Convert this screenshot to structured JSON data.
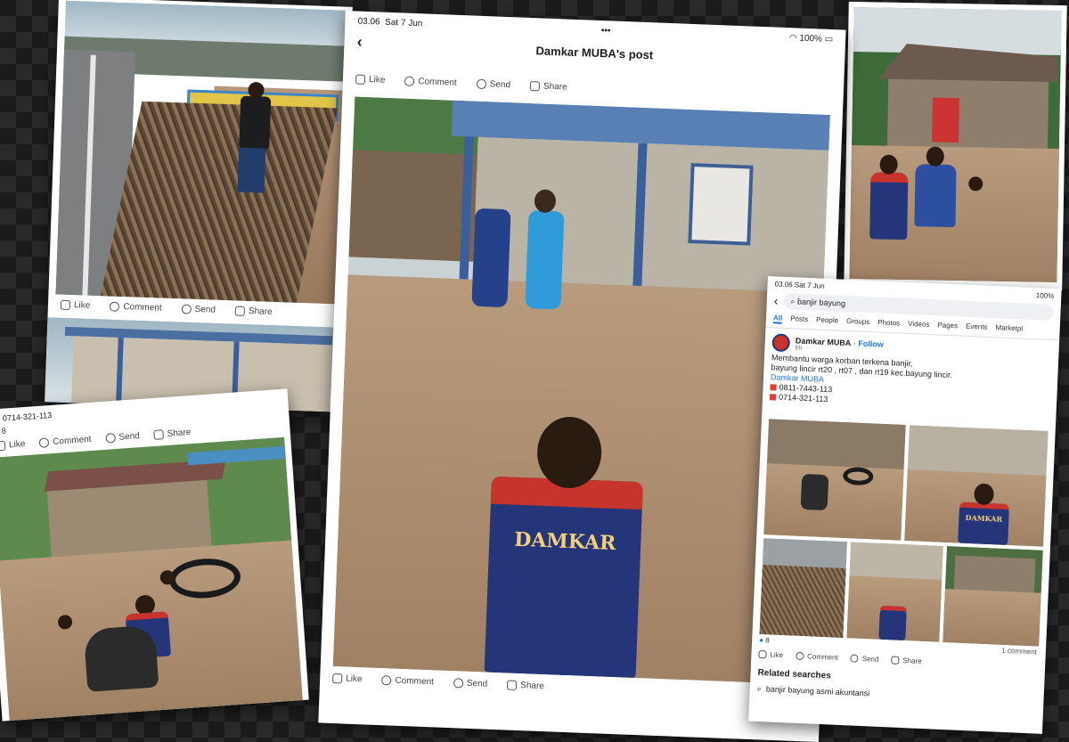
{
  "center": {
    "status": {
      "time": "03.06",
      "date": "Sat 7 Jun",
      "battery": "100%"
    },
    "header_title": "Damkar MUBA's post",
    "actions": {
      "like": "Like",
      "comment": "Comment",
      "send": "Send",
      "share": "Share"
    },
    "shirt_text": "DAMKAR"
  },
  "top_left": {
    "actions": {
      "like": "Like",
      "comment": "Comment",
      "send": "Send",
      "share": "Share"
    }
  },
  "bottom_left": {
    "phone_partial": "0714-321-113",
    "reaction_count": "8",
    "actions": {
      "like": "Like",
      "comment": "Comment",
      "send": "Send",
      "share": "Share"
    }
  },
  "right_search": {
    "status": {
      "time": "03.06",
      "date": "Sat 7 Jun",
      "battery": "100%"
    },
    "search_query": "banjir bayung",
    "tabs": [
      "All",
      "Posts",
      "People",
      "Groups",
      "Photos",
      "Videos",
      "Pages",
      "Events",
      "Marketpl"
    ],
    "post": {
      "author": "Damkar MUBA",
      "follow": "Follow",
      "time": "6h",
      "text_line1": "Membantu warga korban terkena banjir,",
      "text_line2": "bayung lincir rt20 , rt07 , dan rt19 kec.bayung lincir.",
      "link": "Damkar MUBA",
      "phone1": "0811-7443-113",
      "phone2": "0714-321-113",
      "reaction_count": "8",
      "comment_count": "1 comment"
    },
    "actions": {
      "like": "Like",
      "comment": "Comment",
      "send": "Send",
      "share": "Share"
    },
    "related_title": "Related searches",
    "related_item": "banjir bayung asmi akuntansi",
    "shirt_text": "DAMKAR"
  },
  "colors": {
    "fb_blue": "#1877f2",
    "damkar_navy": "#24357a",
    "damkar_red": "#c7342b",
    "flood_water": "#a88a6c"
  }
}
